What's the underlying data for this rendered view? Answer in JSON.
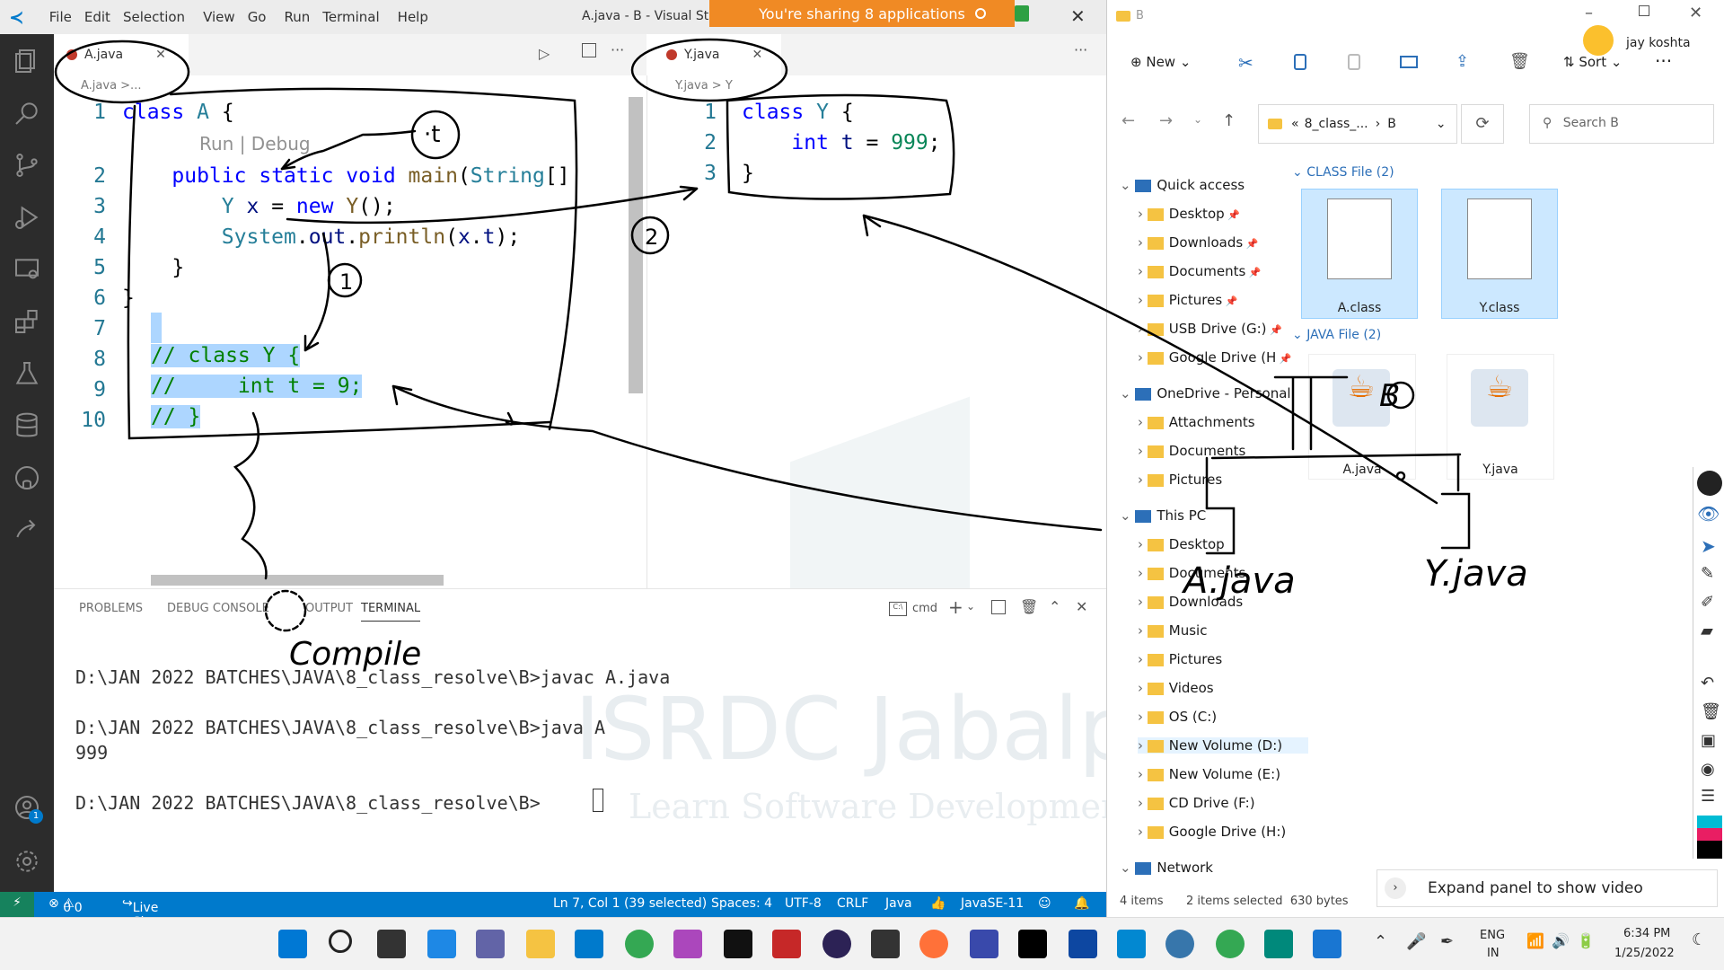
{
  "vscode": {
    "title": "A.java - B - Visual Stu",
    "menu": [
      "File",
      "Edit",
      "Selection",
      "View",
      "Go",
      "Run",
      "Terminal",
      "Help"
    ],
    "share_banner": "You're sharing 8 applications",
    "tabs": {
      "left": {
        "name": "A.java",
        "breadcrumb": "A.java >..."
      },
      "right": {
        "name": "Y.java",
        "breadcrumb": "Y.java > Y"
      }
    },
    "editor_left": {
      "codelens": "Run | Debug",
      "lines": [
        {
          "n": "1",
          "text": "class A {"
        },
        {
          "n": "2",
          "text": "    public static void main(String[]"
        },
        {
          "n": "3",
          "text": "        Y x = new Y();"
        },
        {
          "n": "4",
          "text": "        System.out.println(x.t);"
        },
        {
          "n": "5",
          "text": "    }"
        },
        {
          "n": "6",
          "text": "}"
        },
        {
          "n": "7",
          "text": ""
        },
        {
          "n": "8",
          "text": "// class Y {"
        },
        {
          "n": "9",
          "text": "//     int t = 9;"
        },
        {
          "n": "10",
          "text": "// }"
        }
      ]
    },
    "editor_right": {
      "lines": [
        {
          "n": "1",
          "text": "class Y {"
        },
        {
          "n": "2",
          "text": "    int t = 999;"
        },
        {
          "n": "3",
          "text": "}"
        }
      ]
    },
    "panel": {
      "tabs": [
        "PROBLEMS",
        "DEBUG CONSOLE",
        "OUTPUT",
        "TERMINAL"
      ],
      "shell": "cmd",
      "terminal_lines": [
        "D:\\JAN 2022 BATCHES\\JAVA\\8_class_resolve\\B>javac A.java",
        "",
        "D:\\JAN 2022 BATCHES\\JAVA\\8_class_resolve\\B>java A",
        "999",
        "",
        "D:\\JAN 2022 BATCHES\\JAVA\\8_class_resolve\\B>"
      ]
    },
    "statusbar": {
      "errors": "0",
      "warnings": "0",
      "live_share": "Live Share",
      "position": "Ln 7, Col 1 (39 selected)",
      "spaces": "Spaces: 4",
      "encoding": "UTF-8",
      "eol": "CRLF",
      "language": "Java",
      "runtime": "JavaSE-11",
      "notif_badge": "1"
    },
    "watermark": {
      "title": "ISRDC Jabalpu",
      "subtitle": "Learn Software Development"
    }
  },
  "explorer": {
    "title": "B",
    "user": "jay koshta",
    "toolbar": {
      "new": "New",
      "sort": "Sort"
    },
    "address": {
      "prefix": "«",
      "folder": "8_class_...",
      "current": "B"
    },
    "search_placeholder": "Search B",
    "nav": [
      {
        "label": "Quick access",
        "level": 0,
        "icon": "star-icon"
      },
      {
        "label": "Desktop",
        "level": 1,
        "pin": true
      },
      {
        "label": "Downloads",
        "level": 1,
        "pin": true
      },
      {
        "label": "Documents",
        "level": 1,
        "pin": true
      },
      {
        "label": "Pictures",
        "level": 1,
        "pin": true
      },
      {
        "label": "USB Drive (G:)",
        "level": 1,
        "pin": true
      },
      {
        "label": "Google Drive (H",
        "level": 1,
        "pin": true
      },
      {
        "label": "OneDrive - Personal",
        "level": 0
      },
      {
        "label": "Attachments",
        "level": 1
      },
      {
        "label": "Documents",
        "level": 1
      },
      {
        "label": "Pictures",
        "level": 1
      },
      {
        "label": "This PC",
        "level": 0
      },
      {
        "label": "Desktop",
        "level": 1
      },
      {
        "label": "Documents",
        "level": 1
      },
      {
        "label": "Downloads",
        "level": 1
      },
      {
        "label": "Music",
        "level": 1
      },
      {
        "label": "Pictures",
        "level": 1
      },
      {
        "label": "Videos",
        "level": 1
      },
      {
        "label": "OS (C:)",
        "level": 1
      },
      {
        "label": "New Volume (D:)",
        "level": 1,
        "selected": true
      },
      {
        "label": "New Volume (E:)",
        "level": 1
      },
      {
        "label": "CD Drive (F:)",
        "level": 1
      },
      {
        "label": "Google Drive (H:)",
        "level": 1
      },
      {
        "label": "Network",
        "level": 0
      }
    ],
    "groups": [
      {
        "header": "CLASS File (2)",
        "files": [
          "A.class",
          "Y.class"
        ]
      },
      {
        "header": "JAVA File (2)",
        "files": [
          "A.java",
          "Y.java"
        ]
      }
    ],
    "status": {
      "items": "4 items",
      "selected": "2 items selected  630 bytes"
    },
    "expand_panel": "Expand panel to show video"
  },
  "taskbar": {
    "lang": "ENG",
    "region": "IN",
    "time": "6:34 PM",
    "date": "1/25/2022"
  },
  "annotations": {
    "a1": "A.java",
    "a2": "Y.java",
    "circle1": "1",
    "circle2": "2",
    "dot": "·t",
    "compile": "Compile",
    "b": "B",
    "ajava": "A.java",
    "yjava": "Y.java"
  }
}
